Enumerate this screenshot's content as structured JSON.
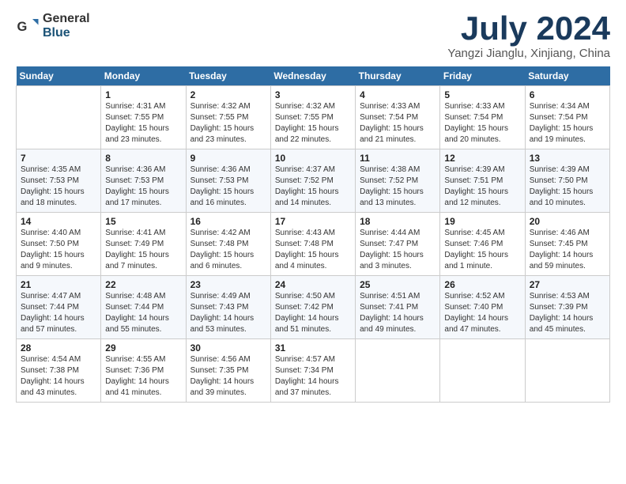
{
  "header": {
    "logo_general": "General",
    "logo_blue": "Blue",
    "month_title": "July 2024",
    "location": "Yangzi Jianglu, Xinjiang, China"
  },
  "weekdays": [
    "Sunday",
    "Monday",
    "Tuesday",
    "Wednesday",
    "Thursday",
    "Friday",
    "Saturday"
  ],
  "weeks": [
    [
      {
        "day": "",
        "info": ""
      },
      {
        "day": "1",
        "info": "Sunrise: 4:31 AM\nSunset: 7:55 PM\nDaylight: 15 hours\nand 23 minutes."
      },
      {
        "day": "2",
        "info": "Sunrise: 4:32 AM\nSunset: 7:55 PM\nDaylight: 15 hours\nand 23 minutes."
      },
      {
        "day": "3",
        "info": "Sunrise: 4:32 AM\nSunset: 7:55 PM\nDaylight: 15 hours\nand 22 minutes."
      },
      {
        "day": "4",
        "info": "Sunrise: 4:33 AM\nSunset: 7:54 PM\nDaylight: 15 hours\nand 21 minutes."
      },
      {
        "day": "5",
        "info": "Sunrise: 4:33 AM\nSunset: 7:54 PM\nDaylight: 15 hours\nand 20 minutes."
      },
      {
        "day": "6",
        "info": "Sunrise: 4:34 AM\nSunset: 7:54 PM\nDaylight: 15 hours\nand 19 minutes."
      }
    ],
    [
      {
        "day": "7",
        "info": "Sunrise: 4:35 AM\nSunset: 7:53 PM\nDaylight: 15 hours\nand 18 minutes."
      },
      {
        "day": "8",
        "info": "Sunrise: 4:36 AM\nSunset: 7:53 PM\nDaylight: 15 hours\nand 17 minutes."
      },
      {
        "day": "9",
        "info": "Sunrise: 4:36 AM\nSunset: 7:53 PM\nDaylight: 15 hours\nand 16 minutes."
      },
      {
        "day": "10",
        "info": "Sunrise: 4:37 AM\nSunset: 7:52 PM\nDaylight: 15 hours\nand 14 minutes."
      },
      {
        "day": "11",
        "info": "Sunrise: 4:38 AM\nSunset: 7:52 PM\nDaylight: 15 hours\nand 13 minutes."
      },
      {
        "day": "12",
        "info": "Sunrise: 4:39 AM\nSunset: 7:51 PM\nDaylight: 15 hours\nand 12 minutes."
      },
      {
        "day": "13",
        "info": "Sunrise: 4:39 AM\nSunset: 7:50 PM\nDaylight: 15 hours\nand 10 minutes."
      }
    ],
    [
      {
        "day": "14",
        "info": "Sunrise: 4:40 AM\nSunset: 7:50 PM\nDaylight: 15 hours\nand 9 minutes."
      },
      {
        "day": "15",
        "info": "Sunrise: 4:41 AM\nSunset: 7:49 PM\nDaylight: 15 hours\nand 7 minutes."
      },
      {
        "day": "16",
        "info": "Sunrise: 4:42 AM\nSunset: 7:48 PM\nDaylight: 15 hours\nand 6 minutes."
      },
      {
        "day": "17",
        "info": "Sunrise: 4:43 AM\nSunset: 7:48 PM\nDaylight: 15 hours\nand 4 minutes."
      },
      {
        "day": "18",
        "info": "Sunrise: 4:44 AM\nSunset: 7:47 PM\nDaylight: 15 hours\nand 3 minutes."
      },
      {
        "day": "19",
        "info": "Sunrise: 4:45 AM\nSunset: 7:46 PM\nDaylight: 15 hours\nand 1 minute."
      },
      {
        "day": "20",
        "info": "Sunrise: 4:46 AM\nSunset: 7:45 PM\nDaylight: 14 hours\nand 59 minutes."
      }
    ],
    [
      {
        "day": "21",
        "info": "Sunrise: 4:47 AM\nSunset: 7:44 PM\nDaylight: 14 hours\nand 57 minutes."
      },
      {
        "day": "22",
        "info": "Sunrise: 4:48 AM\nSunset: 7:44 PM\nDaylight: 14 hours\nand 55 minutes."
      },
      {
        "day": "23",
        "info": "Sunrise: 4:49 AM\nSunset: 7:43 PM\nDaylight: 14 hours\nand 53 minutes."
      },
      {
        "day": "24",
        "info": "Sunrise: 4:50 AM\nSunset: 7:42 PM\nDaylight: 14 hours\nand 51 minutes."
      },
      {
        "day": "25",
        "info": "Sunrise: 4:51 AM\nSunset: 7:41 PM\nDaylight: 14 hours\nand 49 minutes."
      },
      {
        "day": "26",
        "info": "Sunrise: 4:52 AM\nSunset: 7:40 PM\nDaylight: 14 hours\nand 47 minutes."
      },
      {
        "day": "27",
        "info": "Sunrise: 4:53 AM\nSunset: 7:39 PM\nDaylight: 14 hours\nand 45 minutes."
      }
    ],
    [
      {
        "day": "28",
        "info": "Sunrise: 4:54 AM\nSunset: 7:38 PM\nDaylight: 14 hours\nand 43 minutes."
      },
      {
        "day": "29",
        "info": "Sunrise: 4:55 AM\nSunset: 7:36 PM\nDaylight: 14 hours\nand 41 minutes."
      },
      {
        "day": "30",
        "info": "Sunrise: 4:56 AM\nSunset: 7:35 PM\nDaylight: 14 hours\nand 39 minutes."
      },
      {
        "day": "31",
        "info": "Sunrise: 4:57 AM\nSunset: 7:34 PM\nDaylight: 14 hours\nand 37 minutes."
      },
      {
        "day": "",
        "info": ""
      },
      {
        "day": "",
        "info": ""
      },
      {
        "day": "",
        "info": ""
      }
    ]
  ]
}
